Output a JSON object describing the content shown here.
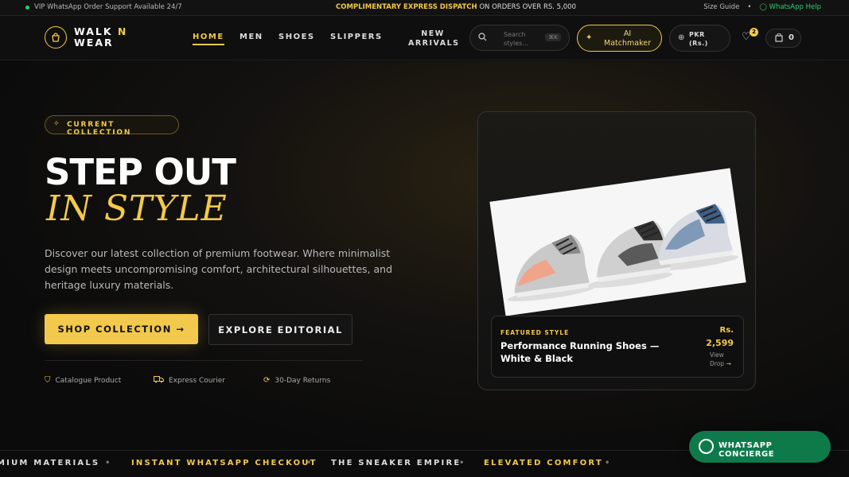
{
  "topbar": {
    "support": "VIP WhatsApp Order Support Available 24/7",
    "promo_bold": "COMPLIMENTARY EXPRESS DISPATCH",
    "promo_rest": "ON ORDERS OVER RS. 5,000",
    "size_guide": "Size Guide",
    "whatsapp_help": "WhatsApp Help"
  },
  "brand": {
    "line1": "WALK",
    "n": "N",
    "line2": "WEAR"
  },
  "nav": {
    "home": "HOME",
    "men": "MEN",
    "shoes": "SHOES",
    "slippers": "SLIPPERS",
    "new1": "NEW",
    "new2": "ARRIVALS"
  },
  "search": {
    "ph1": "Search",
    "ph2": "styles...",
    "kbd": "⌘K"
  },
  "ai": {
    "line1": "AI",
    "line2": "Matchmaker"
  },
  "currency": {
    "line1": "PKR",
    "line2": "(Rs.)"
  },
  "wishlist_count": "2",
  "cart_count": "0",
  "hero": {
    "pill": "CURRENT COLLECTION",
    "title1": "STEP OUT",
    "title2": "IN STYLE",
    "description": "Discover our latest collection of premium footwear. Where minimalist design meets uncompromising comfort, architectural silhouettes, and heritage luxury materials.",
    "cta_primary": "SHOP COLLECTION →",
    "cta_secondary": "EXPLORE EDITORIAL",
    "features": [
      "Catalogue Product",
      "Express Courier",
      "30-Day Returns"
    ]
  },
  "featured": {
    "label": "FEATURED STYLE",
    "name": "Performance Running Shoes — White & Black",
    "currency": "Rs.",
    "price": "2,599",
    "view1": "View",
    "view2": "Drop"
  },
  "marquee": [
    "MIUM MATERIALS",
    "INSTANT WHATSAPP CHECKOUT",
    "THE SNEAKER EMPIRE",
    "ELEVATED COMFORT"
  ],
  "whatsapp_button": "WHATSAPP CONCIERGE",
  "colors": {
    "accent": "#f2c94c",
    "whatsapp": "#0e7a4a",
    "background": "#0d0d0d"
  }
}
